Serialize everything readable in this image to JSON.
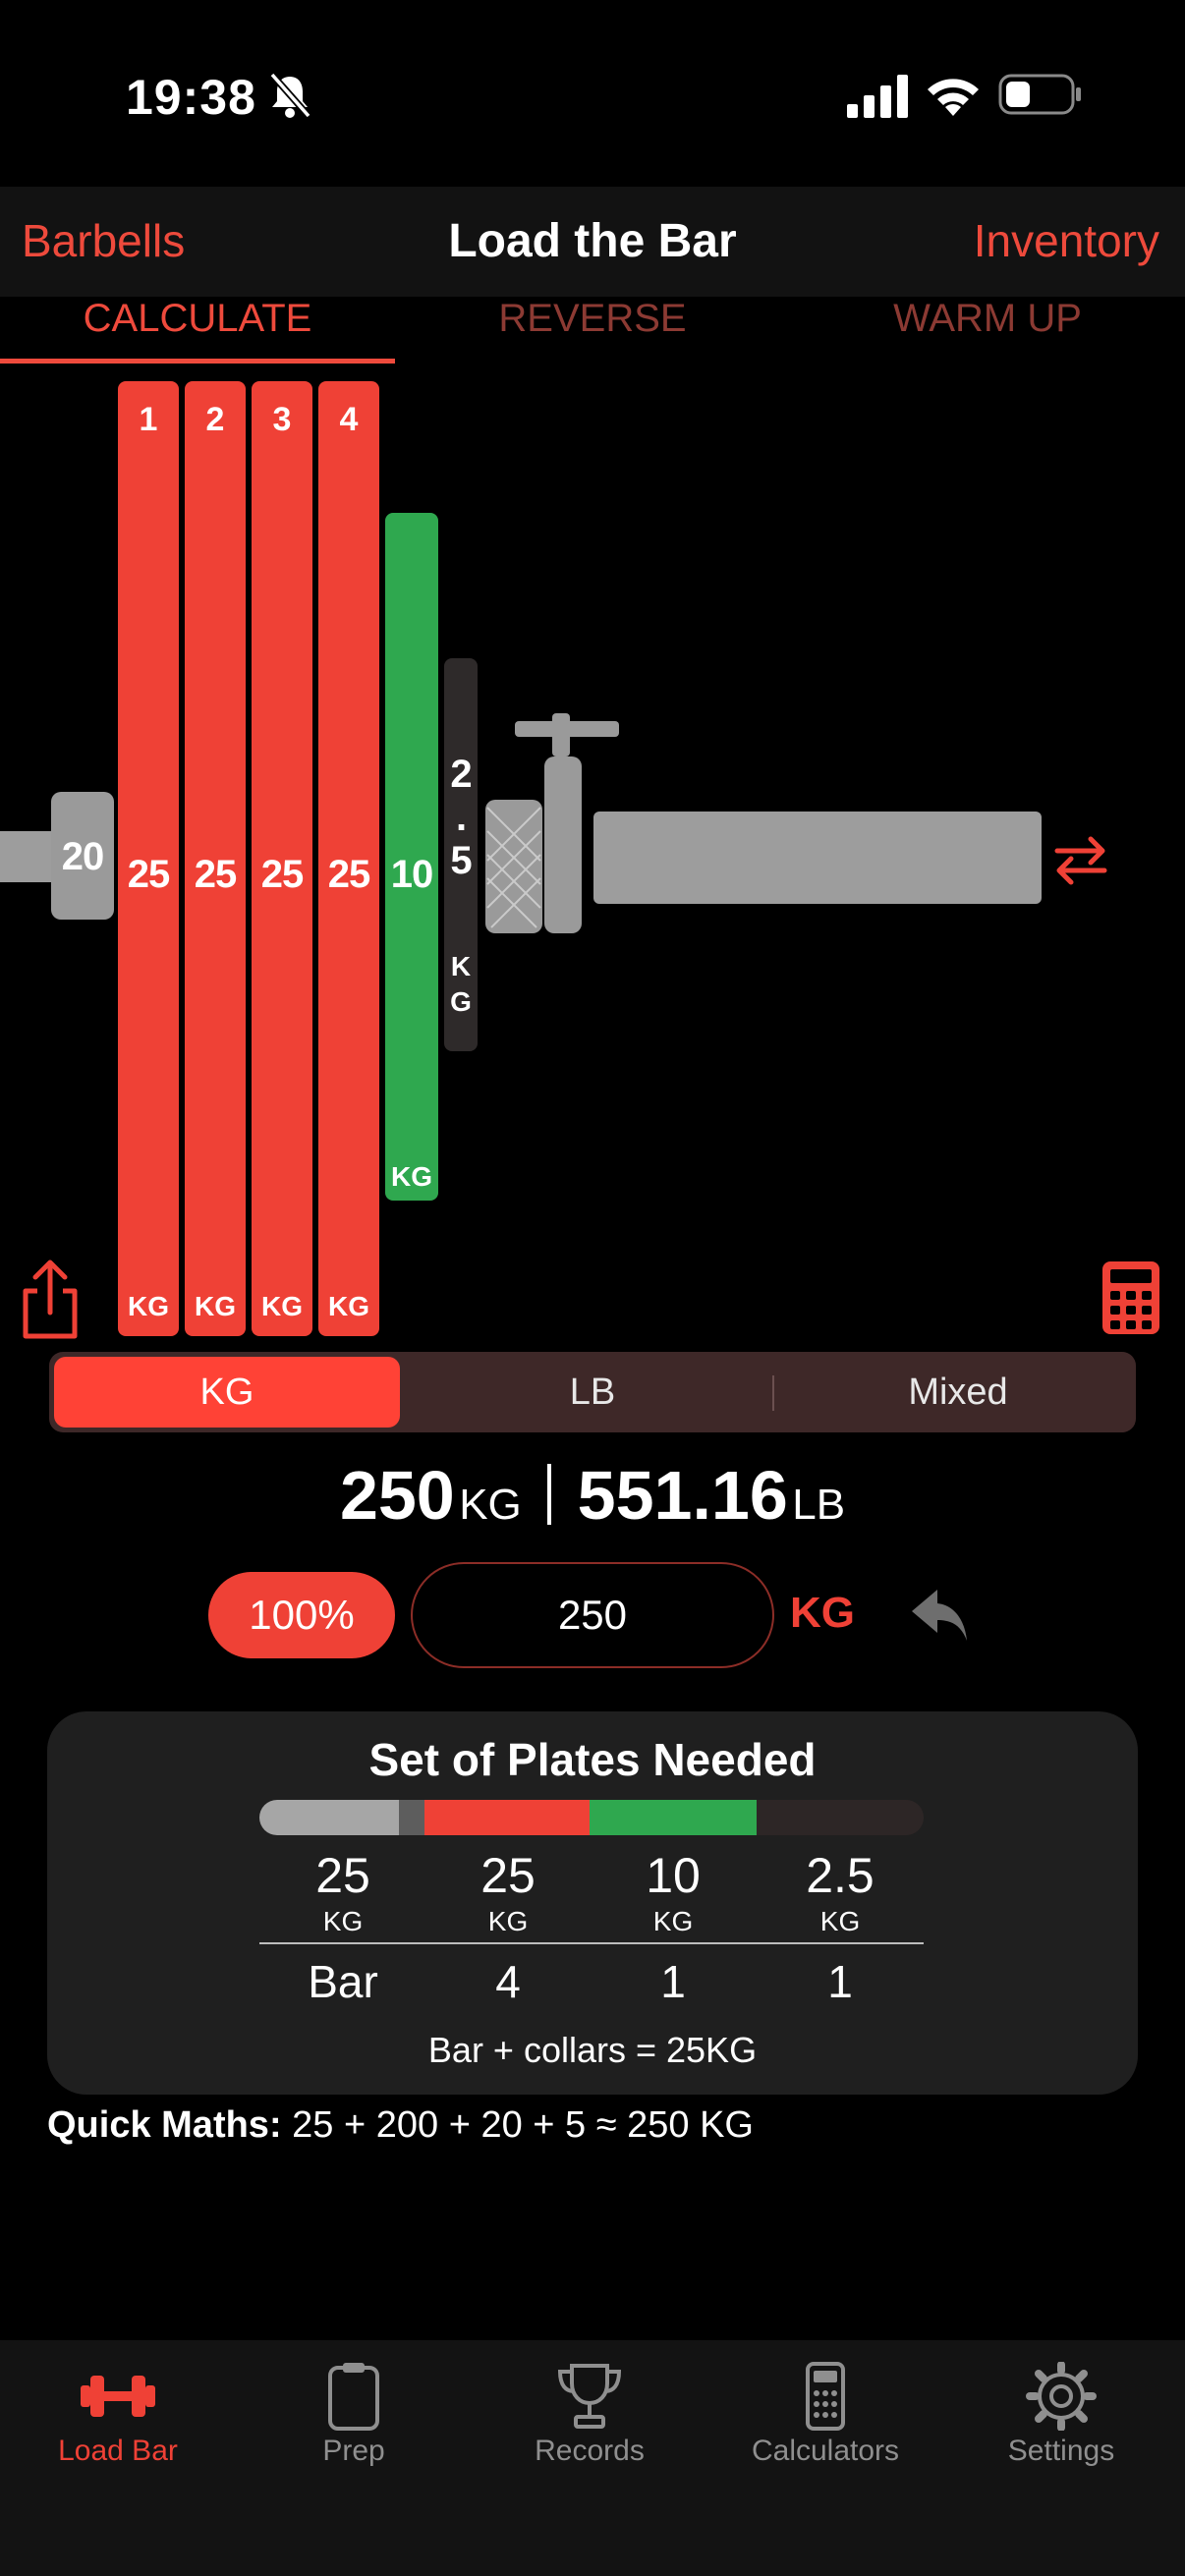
{
  "status": {
    "time": "19:38",
    "icons": [
      "bell-slash-icon",
      "cellular-signal-icon",
      "wifi-icon",
      "battery-icon"
    ]
  },
  "nav": {
    "left": "Barbells",
    "title": "Load the Bar",
    "right": "Inventory"
  },
  "tabs": [
    {
      "label": "CALCULATE",
      "active": true
    },
    {
      "label": "REVERSE",
      "active": false
    },
    {
      "label": "WARM UP",
      "active": false
    }
  ],
  "barbell": {
    "sleeve_label": "20",
    "plates": [
      {
        "index": "1",
        "value": "25",
        "unit": "KG",
        "color": "#ef4136"
      },
      {
        "index": "2",
        "value": "25",
        "unit": "KG",
        "color": "#ef4136"
      },
      {
        "index": "3",
        "value": "25",
        "unit": "KG",
        "color": "#ef4136"
      },
      {
        "index": "4",
        "value": "25",
        "unit": "KG",
        "color": "#ef4136"
      },
      {
        "index": "",
        "value": "10",
        "unit": "KG",
        "color": "#2fa84f"
      },
      {
        "index": "",
        "value": "2\n.\n5",
        "unit": "K\nG",
        "color": "#2e2a2a"
      }
    ]
  },
  "units": {
    "options": [
      "KG",
      "LB",
      "Mixed"
    ],
    "selected": "KG"
  },
  "total": {
    "kg": "250",
    "kg_unit": "KG",
    "lb": "551.16",
    "lb_unit": "LB"
  },
  "input": {
    "percent": "100%",
    "value": "250",
    "unit": "KG"
  },
  "plates_needed": {
    "title": "Set of Plates Needed",
    "columns": [
      {
        "value": "25",
        "unit": "KG",
        "count": "Bar"
      },
      {
        "value": "25",
        "unit": "KG",
        "count": "4"
      },
      {
        "value": "10",
        "unit": "KG",
        "count": "1"
      },
      {
        "value": "2.5",
        "unit": "KG",
        "count": "1"
      }
    ],
    "strip_colors": [
      "#a6a6a6",
      "#5d5d5d",
      "#ef4136",
      "#2fa84f",
      "#2d2626"
    ],
    "note": "Bar + collars = 25KG"
  },
  "quick_maths": {
    "label": "Quick Maths:",
    "expr": " 25 + 200 + 20 + 5 ≈ 250 KG"
  },
  "tabbar": [
    {
      "label": "Load Bar",
      "icon": "dumbbell-icon",
      "active": true
    },
    {
      "label": "Prep",
      "icon": "clipboard-icon",
      "active": false
    },
    {
      "label": "Records",
      "icon": "trophy-icon",
      "active": false
    },
    {
      "label": "Calculators",
      "icon": "calculator-icon",
      "active": false
    },
    {
      "label": "Settings",
      "icon": "gear-icon",
      "active": false
    }
  ],
  "colors": {
    "accent": "#ef4136",
    "green": "#2fa84f",
    "card": "#1f1f1f",
    "segment": "#3e2828"
  }
}
